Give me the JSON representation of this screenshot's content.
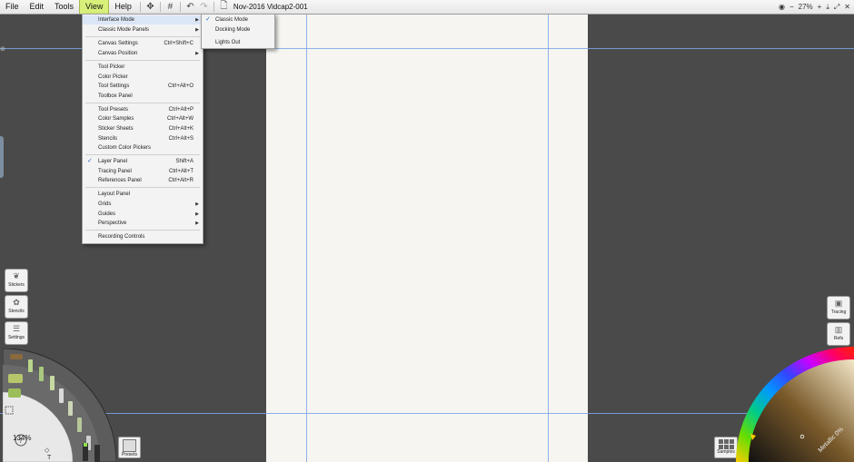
{
  "menubar": {
    "items": [
      "File",
      "Edit",
      "Tools",
      "View",
      "Help"
    ],
    "document_title": "Nov-2016 Vidcap2-001",
    "zoom_level": "27%"
  },
  "view_menu": {
    "items": [
      {
        "label": "Interface Mode",
        "shortcut": "",
        "submenu": true,
        "checked": false
      },
      {
        "label": "Classic Mode Panels",
        "shortcut": "",
        "submenu": true,
        "checked": false
      },
      {
        "label": "Canvas Settings",
        "shortcut": "Ctrl+Shift+C",
        "submenu": false,
        "checked": false
      },
      {
        "label": "Canvas Position",
        "shortcut": "",
        "submenu": true,
        "checked": false
      },
      {
        "label": "Tool Picker",
        "shortcut": "",
        "submenu": false,
        "checked": false
      },
      {
        "label": "Color Picker",
        "shortcut": "",
        "submenu": false,
        "checked": false
      },
      {
        "label": "Tool Settings",
        "shortcut": "Ctrl+Alt+O",
        "submenu": false,
        "checked": false
      },
      {
        "label": "Toolbox Panel",
        "shortcut": "",
        "submenu": false,
        "checked": false
      },
      {
        "label": "Tool Presets",
        "shortcut": "Ctrl+Alt+P",
        "submenu": false,
        "checked": false
      },
      {
        "label": "Color Samples",
        "shortcut": "Ctrl+Alt+W",
        "submenu": false,
        "checked": false
      },
      {
        "label": "Sticker Sheets",
        "shortcut": "Ctrl+Alt+K",
        "submenu": false,
        "checked": false
      },
      {
        "label": "Stencils",
        "shortcut": "Ctrl+Alt+S",
        "submenu": false,
        "checked": false
      },
      {
        "label": "Custom Color Pickers",
        "shortcut": "",
        "submenu": false,
        "checked": false
      },
      {
        "label": "Layer Panel",
        "shortcut": "Shift+A",
        "submenu": false,
        "checked": true
      },
      {
        "label": "Tracing Panel",
        "shortcut": "Ctrl+Alt+T",
        "submenu": false,
        "checked": false
      },
      {
        "label": "References Panel",
        "shortcut": "Ctrl+Alt+R",
        "submenu": false,
        "checked": false
      },
      {
        "label": "Layout Panel",
        "shortcut": "",
        "submenu": false,
        "checked": false
      },
      {
        "label": "Grids",
        "shortcut": "",
        "submenu": true,
        "checked": false
      },
      {
        "label": "Guides",
        "shortcut": "",
        "submenu": true,
        "checked": false
      },
      {
        "label": "Perspective",
        "shortcut": "",
        "submenu": true,
        "checked": false
      },
      {
        "label": "Recording Controls",
        "shortcut": "",
        "submenu": false,
        "checked": false
      }
    ]
  },
  "interface_mode_submenu": {
    "items": [
      {
        "label": "Classic Mode",
        "checked": true
      },
      {
        "label": "Docking Mode",
        "checked": false
      },
      {
        "label": "Lights Out",
        "checked": false
      }
    ]
  },
  "left_panel": {
    "stickers_label": "Stickers",
    "stencils_label": "Stencils",
    "settings_label": "Settings",
    "zoom_percent": "134%",
    "presets_label": "Presets"
  },
  "right_panel": {
    "tracing_label": "Tracing",
    "refs_label": "Refs",
    "samples_label": "Samples",
    "metallic_label": "Metallic 0%"
  }
}
